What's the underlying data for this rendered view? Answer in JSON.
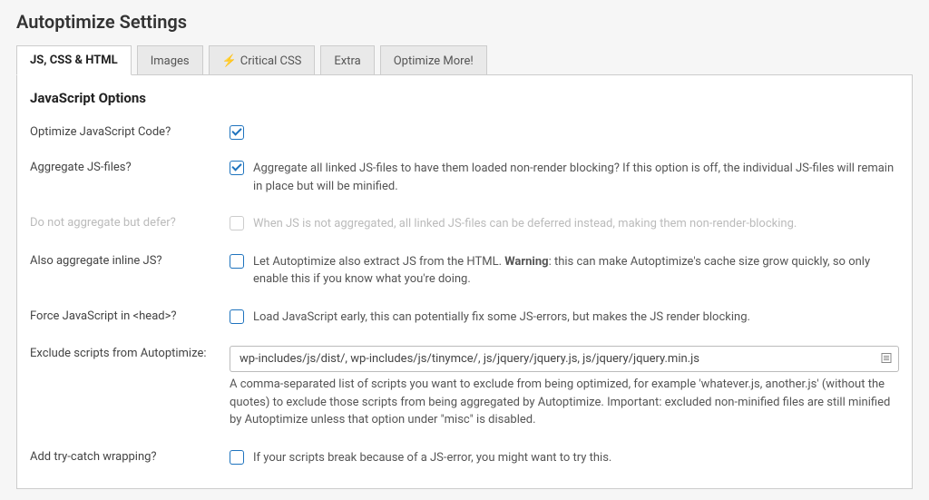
{
  "page": {
    "title": "Autoptimize Settings"
  },
  "tabs": {
    "jscsshtml": "JS, CSS & HTML",
    "images": "Images",
    "criticalcss": "Critical CSS",
    "extra": "Extra",
    "optimizemore": "Optimize More!"
  },
  "section": {
    "title": "JavaScript Options"
  },
  "opt_js": {
    "label": "Optimize JavaScript Code?"
  },
  "aggregate": {
    "label": "Aggregate JS-files?",
    "desc": "Aggregate all linked JS-files to have them loaded non-render blocking? If this option is off, the individual JS-files will remain in place but will be minified."
  },
  "defer": {
    "label": "Do not aggregate but defer?",
    "desc": "When JS is not aggregated, all linked JS-files can be deferred instead, making them non-render-blocking."
  },
  "inlinejs": {
    "label": "Also aggregate inline JS?",
    "desc_pre": "Let Autoptimize also extract JS from the HTML. ",
    "desc_bold": "Warning",
    "desc_post": ": this can make Autoptimize's cache size grow quickly, so only enable this if you know what you're doing."
  },
  "forcehead": {
    "label": "Force JavaScript in <head>?",
    "desc": "Load JavaScript early, this can potentially fix some JS-errors, but makes the JS render blocking."
  },
  "exclude": {
    "label": "Exclude scripts from Autoptimize:",
    "value": "wp-includes/js/dist/, wp-includes/js/tinymce/, js/jquery/jquery.js, js/jquery/jquery.min.js",
    "desc": "A comma-separated list of scripts you want to exclude from being optimized, for example 'whatever.js, another.js' (without the quotes) to exclude those scripts from being aggregated by Autoptimize. Important: excluded non-minified files are still minified by Autoptimize unless that option under \"misc\" is disabled."
  },
  "trycatch": {
    "label": "Add try-catch wrapping?",
    "desc": "If your scripts break because of a JS-error, you might want to try this."
  }
}
